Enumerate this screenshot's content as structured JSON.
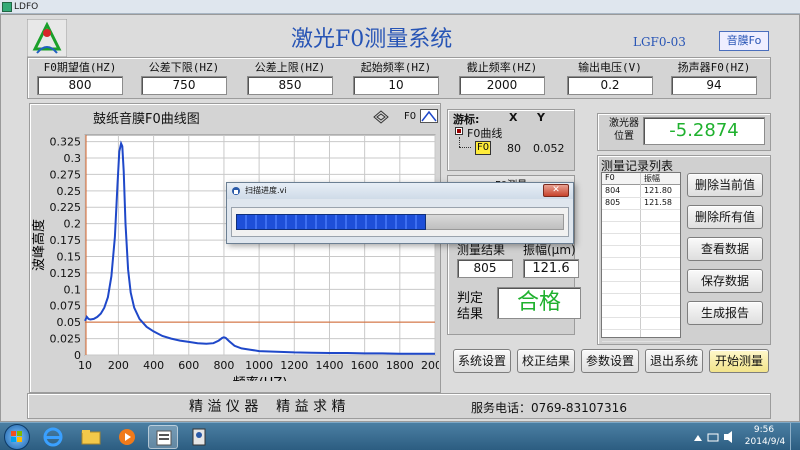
{
  "window": {
    "title": "LDFO"
  },
  "header": {
    "title": "激光F0测量系统",
    "code": "LGF0-03",
    "mode_button": "音膜Fo"
  },
  "params": [
    {
      "label": "F0期望值(HZ)",
      "value": "800"
    },
    {
      "label": "公差下限(HZ)",
      "value": "750"
    },
    {
      "label": "公差上限(HZ)",
      "value": "850"
    },
    {
      "label": "起始频率(HZ)",
      "value": "10"
    },
    {
      "label": "截止频率(HZ)",
      "value": "2000"
    },
    {
      "label": "输出电压(V)",
      "value": "0.2"
    },
    {
      "label": "扬声器F0(HZ)",
      "value": "94"
    }
  ],
  "chart_panel": {
    "title": "鼓纸音膜F0曲线图",
    "legend_label": "F0"
  },
  "chart_data": {
    "type": "line",
    "xlabel": "频率(HZ)",
    "ylabel": "波峰高度",
    "xlim": [
      10,
      2000
    ],
    "ylim": [
      0,
      0.335
    ],
    "x_ticks": [
      "10",
      "200",
      "400",
      "600",
      "800",
      "1000",
      "1200",
      "1400",
      "1600",
      "1800",
      "2000"
    ],
    "y_ticks": [
      "0",
      "0.025",
      "0.05",
      "0.075",
      "0.1",
      "0.125",
      "0.15",
      "0.175",
      "0.2",
      "0.225",
      "0.25",
      "0.275",
      "0.3",
      "0.325"
    ],
    "cursor": {
      "x": 10,
      "y": 0.052
    },
    "series": [
      {
        "x": [
          10,
          20,
          30,
          40,
          60,
          80,
          100,
          120,
          140,
          160,
          180,
          195,
          205,
          215,
          222,
          230,
          240,
          255,
          270,
          290,
          320,
          360,
          400,
          450,
          500,
          550,
          600,
          650,
          700,
          740,
          770,
          790,
          800,
          810,
          830,
          860,
          900,
          950,
          1000,
          1100,
          1200,
          1300,
          1400,
          1500,
          1600,
          1700,
          1800,
          1900,
          2000
        ],
        "y": [
          0.052,
          0.058,
          0.055,
          0.054,
          0.055,
          0.058,
          0.063,
          0.072,
          0.088,
          0.12,
          0.18,
          0.26,
          0.31,
          0.322,
          0.318,
          0.28,
          0.2,
          0.13,
          0.095,
          0.072,
          0.055,
          0.043,
          0.036,
          0.029,
          0.025,
          0.022,
          0.02,
          0.018,
          0.017,
          0.018,
          0.022,
          0.026,
          0.027,
          0.026,
          0.021,
          0.014,
          0.01,
          0.008,
          0.006,
          0.005,
          0.004,
          0.0035,
          0.003,
          0.003,
          0.0025,
          0.0025,
          0.002,
          0.002,
          0.002
        ]
      }
    ],
    "hline": 0.05,
    "vline": 10
  },
  "cursor_panel": {
    "title": "游标:",
    "x_header": "X",
    "y_header": "Y",
    "tree_label": "F0曲线",
    "item": "F0",
    "x": "80",
    "y": "0.052"
  },
  "f0_tab": "F0测量",
  "measure": {
    "result_label": "测量结果",
    "amp_label": "振幅(μm)",
    "result": "805",
    "amp": "121.6",
    "judge_label": "判定\n结果",
    "judge": "合格"
  },
  "laser": {
    "label": "激光器\n位置",
    "value": "-5.2874"
  },
  "records": {
    "title": "测量记录列表",
    "headers": [
      "F0",
      "振幅"
    ],
    "rows": [
      [
        "804",
        "121.80"
      ],
      [
        "805",
        "121.58"
      ]
    ]
  },
  "side_buttons": [
    "删除当前值",
    "删除所有值",
    "查看数据",
    "保存数据",
    "生成报告"
  ],
  "bottom_buttons": [
    "系统设置",
    "校正结果",
    "参数设置",
    "退出系统",
    "开始测量"
  ],
  "footer": {
    "slogan": "精 溢 仪 器    精 益 求 精",
    "phone": "服务电话：0769-83107316"
  },
  "dialog": {
    "title": "扫描进度.vi",
    "progress": 0.58
  },
  "taskbar": {
    "time": "9:56",
    "date": "2014/9/4"
  }
}
